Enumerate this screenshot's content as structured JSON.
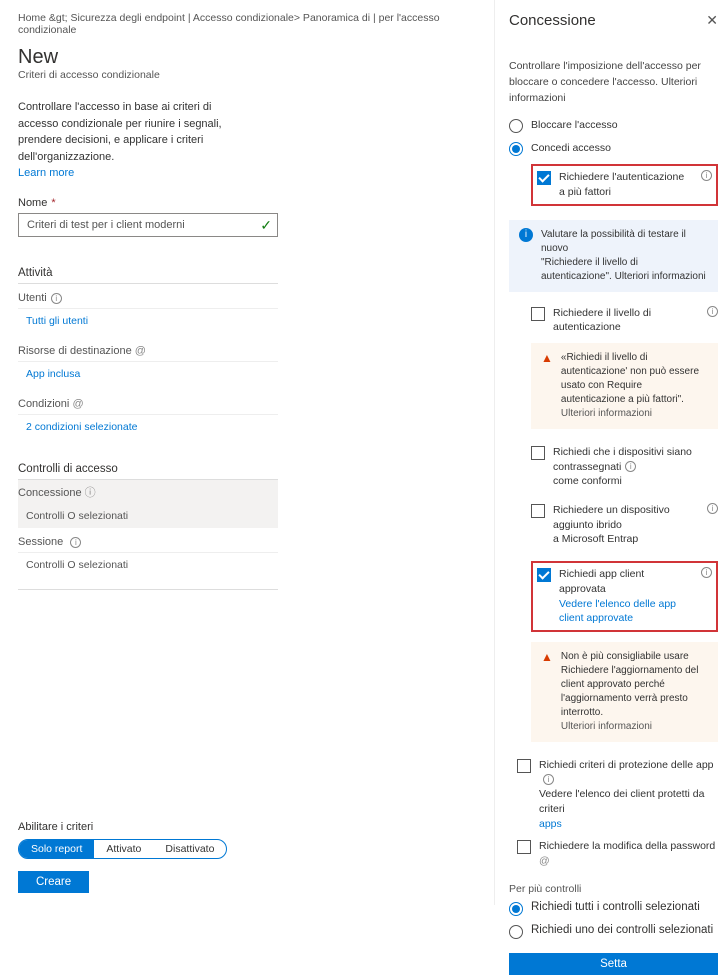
{
  "breadcrumb": "Home &gt;   Sicurezza degli endpoint | Accesso condizionale>   Panoramica di | per l'accesso condizionale",
  "page": {
    "title": "New",
    "subtitle": "Criteri di accesso condizionale"
  },
  "description": {
    "l1": "Controllare l'accesso in base ai criteri di",
    "l2": "accesso condizionale per riunire i segnali,",
    "l3": "prendere decisioni, e applicare i criteri dell'organizzazione.",
    "learn": "Learn more"
  },
  "name": {
    "label": "Nome",
    "value": "Criteri di test per i client moderni"
  },
  "sections": {
    "attivita": "Attività",
    "utenti_label": "Utenti",
    "utenti_val": "Tutti gli utenti",
    "risorse_label": "Risorse di destinazione",
    "risorse_val": "App inclusa",
    "condizioni_label": "Condizioni",
    "condizioni_val": "2 condizioni selezionate",
    "controlli_hdr": "Controlli di accesso",
    "concessione_label": "Concessione",
    "concessione_val": "Controlli O selezionati",
    "sessione_label": "Sessione",
    "sessione_val": "Controlli O selezionati"
  },
  "enable": {
    "label": "Abilitare i criteri",
    "opt1": "Solo report",
    "opt2": "Attivato",
    "opt3": "Disattivato"
  },
  "create_btn": "Creare",
  "panel": {
    "title": "Concessione",
    "desc": "Controllare l'imposizione dell'accesso per bloccare o concedere l'accesso. Ulteriori informazioni",
    "radio_block": "Bloccare l'accesso",
    "radio_grant": "Concedi accesso",
    "mfa": {
      "line1": "Richiedere l'autenticazione",
      "line2": "a più fattori"
    },
    "info_callout": {
      "l1": "Valutare la possibilità di testare il nuovo",
      "l2": "\"Richiedere il livello di",
      "l3": "autenticazione\". Ulteriori informazioni"
    },
    "auth_strength": {
      "line1": "Richiedere il livello di",
      "line2": "autenticazione"
    },
    "warn1": {
      "t": "«Richiedi il livello di autenticazione' non può essere usato con Require autenticazione a più fattori\".",
      "link": "Ulteriori informazioni"
    },
    "compliant": {
      "l1": "Richiedi che i dispositivi siano contrassegnati",
      "l2": "come conformi"
    },
    "hybrid": {
      "l1": "Richiedere un dispositivo aggiunto ibrido",
      "l2": "a Microsoft Entrap"
    },
    "approved": {
      "l1": "Richiedi app client approvata",
      "l2": "Vedere l'elenco delle app client approvate"
    },
    "warn2": {
      "t": "Non è più consigliabile usare Richiedere l'aggiornamento del client approvato perché l'aggiornamento verrà presto interrotto.",
      "link": "Ulteriori informazioni"
    },
    "prot_policy": {
      "l1": "Richiedi criteri di protezione delle app",
      "l2": "Vedere l'elenco dei client protetti da criteri",
      "link": "apps"
    },
    "pw_change": "Richiedere la modifica della password",
    "multi_label": "Per più controlli",
    "multi_all": "Richiedi tutti i controlli selezionati",
    "multi_any": "Richiedi uno dei controlli selezionati",
    "select_btn": "Setta"
  }
}
